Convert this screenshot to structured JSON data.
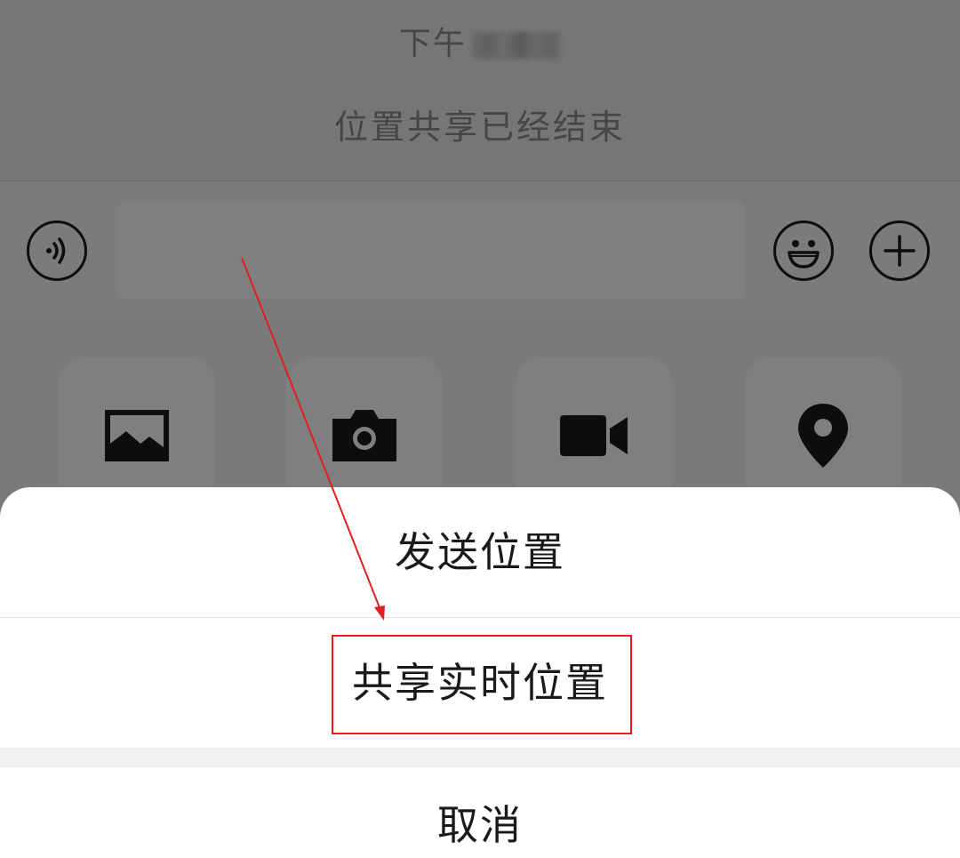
{
  "chat": {
    "timestamp_prefix": "下午",
    "system_message": "位置共享已经结束"
  },
  "input_bar": {
    "voice_icon": "voice-icon",
    "emoji_icon": "emoji-icon",
    "plus_icon": "plus-icon"
  },
  "tools": [
    {
      "icon": "image-icon"
    },
    {
      "icon": "camera-icon"
    },
    {
      "icon": "video-icon"
    },
    {
      "icon": "location-icon"
    }
  ],
  "action_sheet": {
    "send_location": "发送位置",
    "share_live_location": "共享实时位置",
    "cancel": "取消"
  },
  "annotation": {
    "arrow_color": "#e02020",
    "box_color": "#e02020"
  },
  "colors": {
    "overlay": "rgba(0,0,0,0.5)",
    "sheet_bg": "#ffffff",
    "text": "#1a1a1a"
  }
}
